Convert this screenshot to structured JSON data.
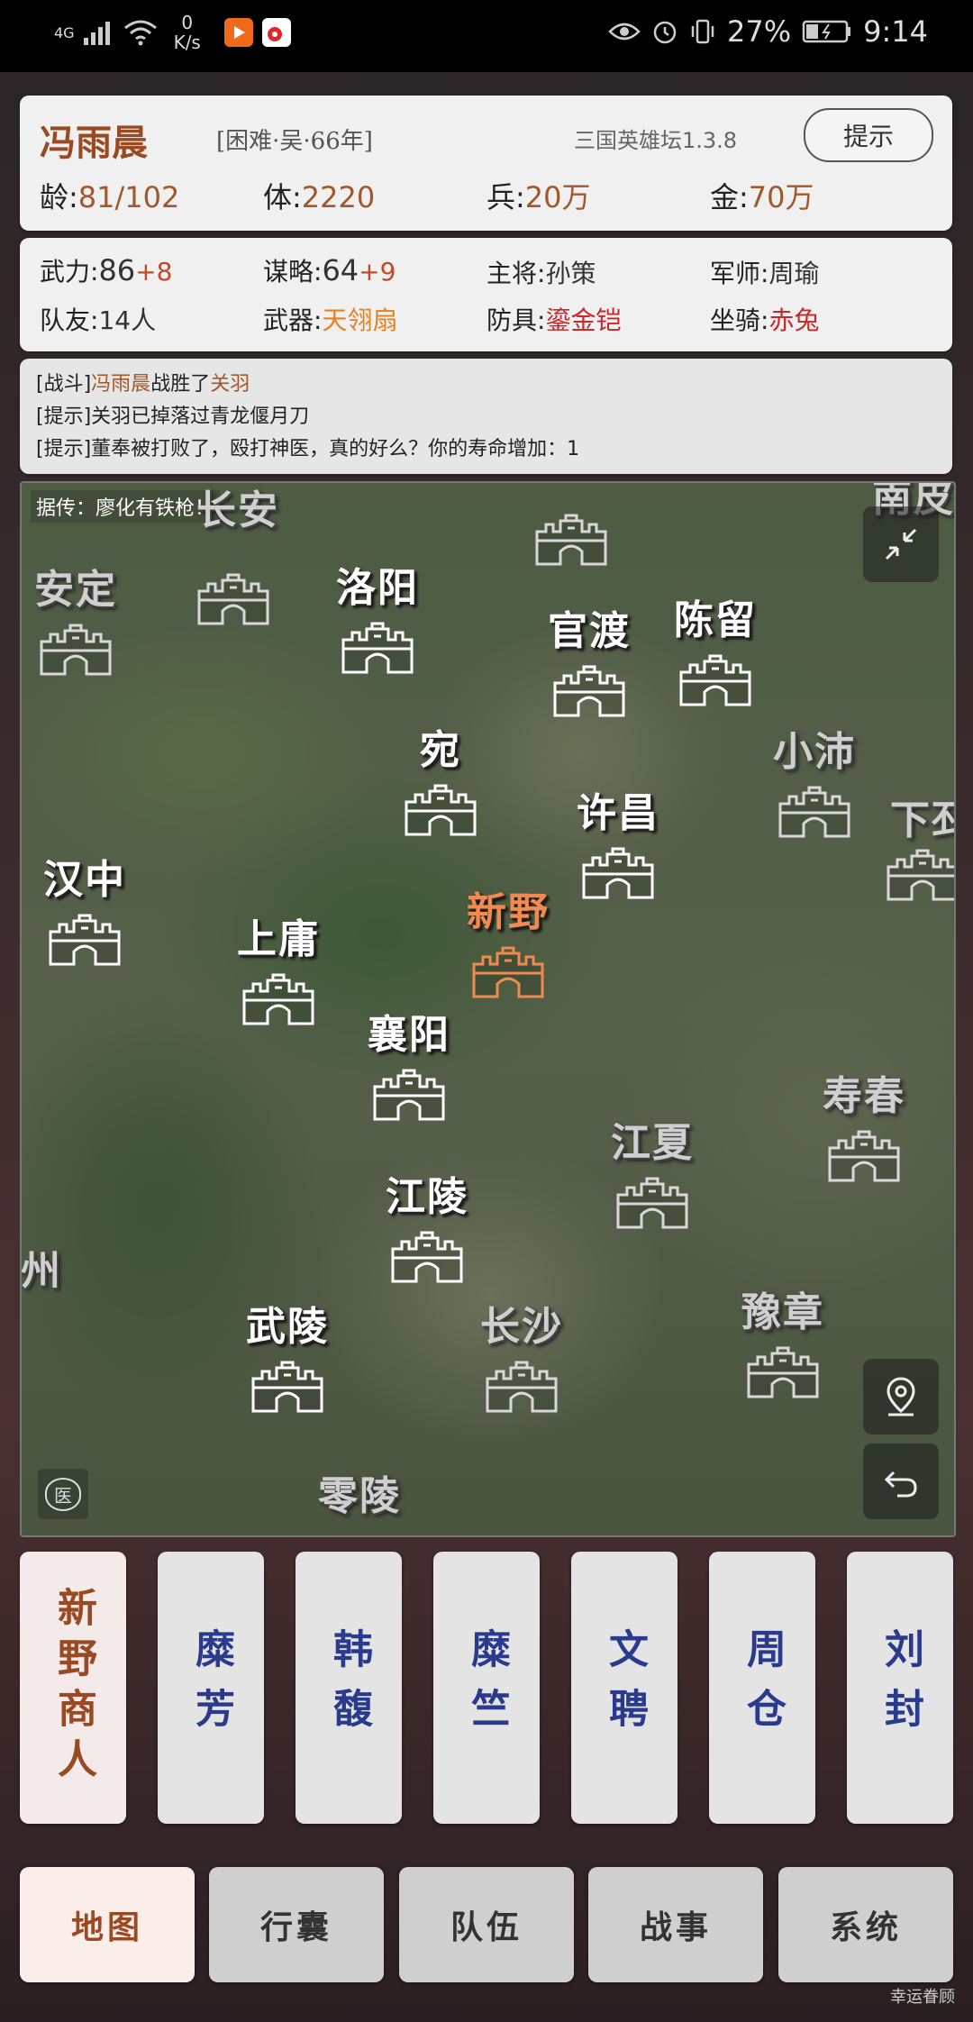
{
  "status": {
    "signal": "4G",
    "net_speed": "0",
    "net_unit": "K/s",
    "battery": "27%",
    "time": "9:14"
  },
  "header": {
    "name": "冯雨晨",
    "difficulty": "[困难·吴·66年]",
    "version": "三国英雄坛1.3.8",
    "hint_btn": "提示",
    "age_label": "龄:",
    "age": "81/102",
    "hp_label": "体:",
    "hp": "2220",
    "soldiers_label": "兵:",
    "soldiers": "20万",
    "gold_label": "金:",
    "gold": "70万"
  },
  "stats": {
    "force_label": "武力:",
    "force": "86",
    "force_plus": "+8",
    "strategy_label": "谋略:",
    "strategy": "64",
    "strategy_plus": "+9",
    "general_label": "主将:",
    "general": "孙策",
    "advisor_label": "军师:",
    "advisor": "周瑜",
    "team_label": "队友:",
    "team": "14人",
    "weapon_label": "武器:",
    "weapon": "天翎扇",
    "armor_label": "防具:",
    "armor": "鎏金铠",
    "mount_label": "坐骑:",
    "mount": "赤兔"
  },
  "log": [
    {
      "tag": "[战斗]",
      "a": "冯雨晨",
      "mid": "战胜了",
      "b": "关羽"
    },
    {
      "tag": "[提示]",
      "text": "关羽已掉落过青龙偃月刀"
    },
    {
      "tag": "[提示]",
      "text": "董奉被打败了，殴打神医，真的好么？你的寿命增加：1"
    }
  ],
  "map": {
    "rumor": "据传：廖化有铁枪！",
    "cities": {
      "changan": "长安",
      "anding": "安定",
      "luoyang": "洛阳",
      "guandu": "官渡",
      "chenliu": "陈留",
      "wan": "宛",
      "xiaopei": "小沛",
      "xupi": "下邳",
      "xuchang": "许昌",
      "hanzhong": "汉中",
      "xinye": "新野",
      "shangyong": "上庸",
      "xiangyang": "襄阳",
      "shouchun": "寿春",
      "jiangxia": "江夏",
      "jiangling": "江陵",
      "zhou": "州",
      "wuling": "武陵",
      "changsha": "长沙",
      "yuzhang": "豫章",
      "lingling": "零陵",
      "top_edge": "南皮"
    },
    "doc_badge": "医"
  },
  "characters": [
    "新野商人",
    "糜芳",
    "韩馥",
    "糜竺",
    "文聘",
    "周仓",
    "刘封"
  ],
  "nav": {
    "map": "地图",
    "bag": "行囊",
    "team": "队伍",
    "war": "战事",
    "system": "系统"
  },
  "watermark": "幸运眷顾"
}
